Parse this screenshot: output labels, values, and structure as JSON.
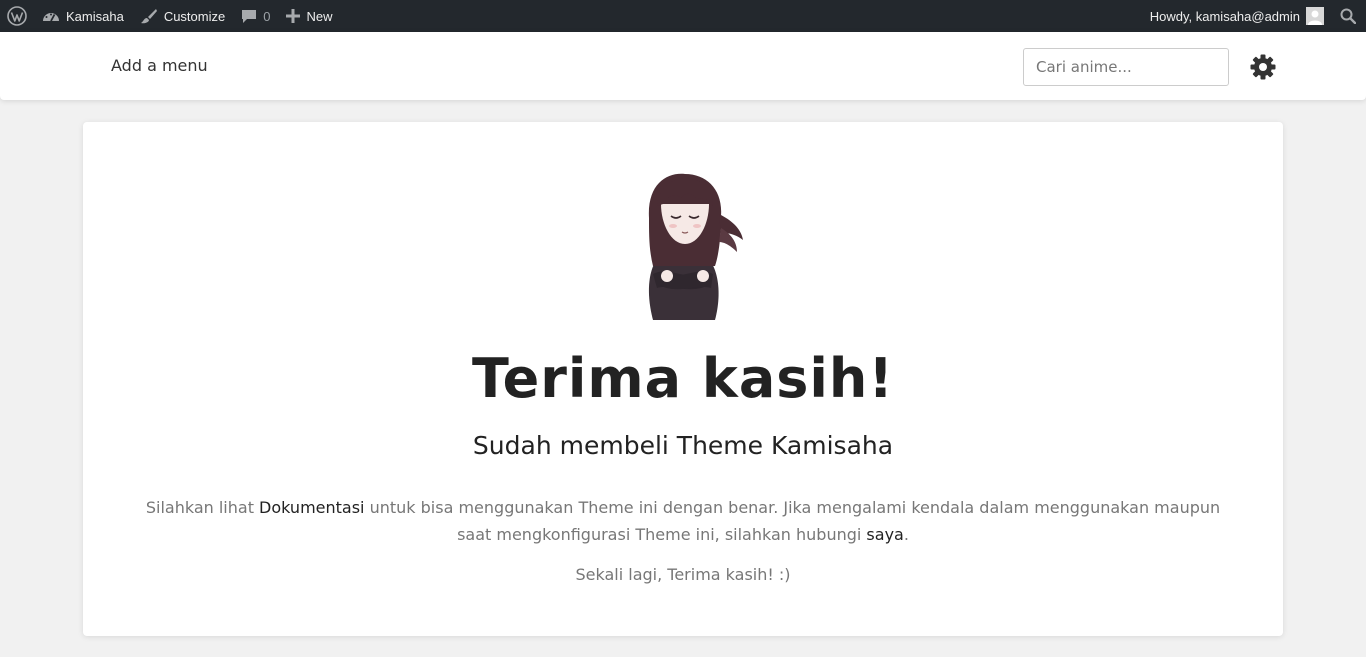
{
  "adminbar": {
    "site_name": "Kamisaha",
    "customize": "Customize",
    "comments_count": "0",
    "new": "New",
    "howdy": "Howdy, kamisaha@admin"
  },
  "header": {
    "menu_link": "Add a menu",
    "search_placeholder": "Cari anime..."
  },
  "content": {
    "title": "Terima kasih!",
    "subtitle": "Sudah membeli Theme Kamisaha",
    "desc_part1": "Silahkan lihat ",
    "desc_link_docs": "Dokumentasi",
    "desc_part2": " untuk bisa menggunakan Theme ini dengan benar. Jika mengalami kendala dalam menggunakan maupun saat mengkonfigurasi Theme ini, silahkan hubungi ",
    "desc_link_contact": "saya",
    "desc_part3": ".",
    "closing": "Sekali lagi, Terima kasih! :)"
  },
  "colors": {
    "adminbar_bg": "#23282d",
    "page_bg": "#f1f1f1",
    "text_dark": "#222222",
    "text_muted": "#777777"
  },
  "icons": {
    "wordpress": "wordpress-logo-icon",
    "dashboard": "dashboard-gauge-icon",
    "customize": "paintbrush-icon",
    "comments": "comment-bubble-icon",
    "new": "plus-icon",
    "search": "search-icon",
    "settings": "gear-icon"
  }
}
